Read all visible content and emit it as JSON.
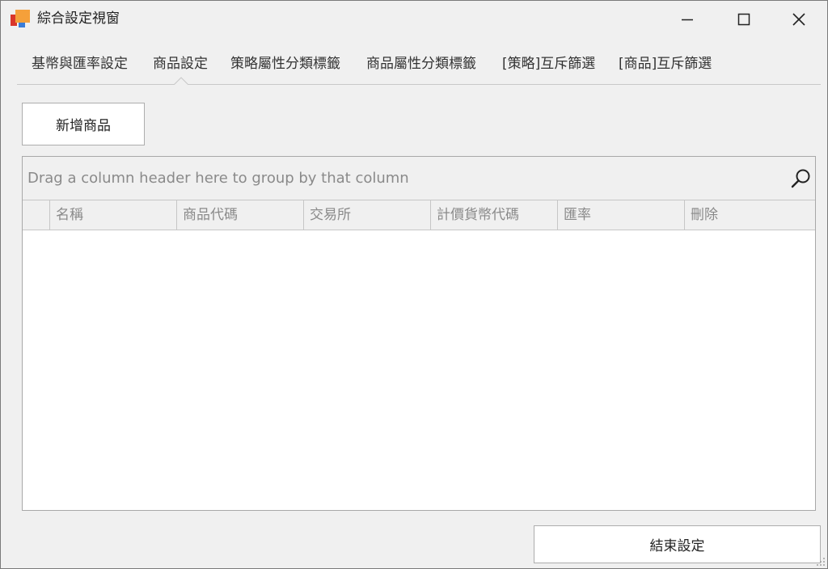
{
  "window": {
    "title": "綜合設定視窗",
    "colors": {
      "logo_red": "#d9362b",
      "logo_orange": "#f5a03a",
      "logo_blue": "#3b7dd8"
    }
  },
  "tabs": [
    {
      "label": "基幣與匯率設定"
    },
    {
      "label": "商品設定",
      "selected": true
    },
    {
      "label": "策略屬性分類標籤"
    },
    {
      "label": "商品屬性分類標籤"
    },
    {
      "label": "[策略]互斥篩選"
    },
    {
      "label": "[商品]互斥篩選"
    }
  ],
  "toolbar": {
    "add_product_label": "新增商品"
  },
  "grid": {
    "group_hint": "Drag a column header here to group by that column",
    "columns": [
      {
        "label": "名稱"
      },
      {
        "label": "商品代碼"
      },
      {
        "label": "交易所"
      },
      {
        "label": "計價貨幣代碼"
      },
      {
        "label": "匯率"
      },
      {
        "label": "刪除"
      }
    ],
    "rows": []
  },
  "footer": {
    "end_settings_label": "結束設定"
  }
}
